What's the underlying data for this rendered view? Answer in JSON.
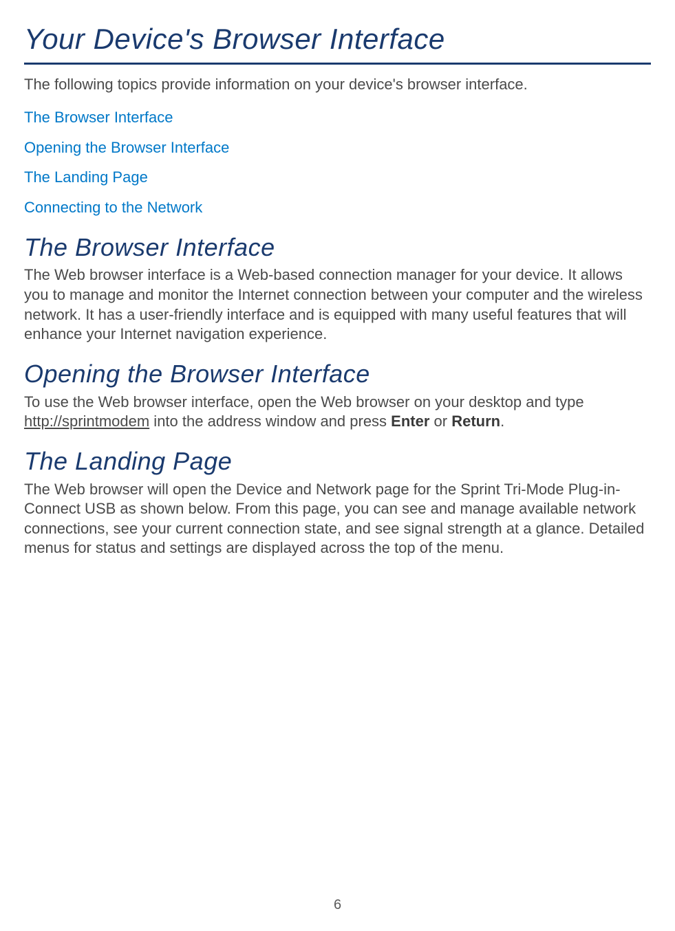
{
  "title": "Your Device's Browser Interface",
  "intro": "The following topics provide information on your device's browser interface.",
  "toc": {
    "items": [
      {
        "label": "The Browser Interface"
      },
      {
        "label": "Opening the Browser Interface"
      },
      {
        "label": "The Landing Page"
      },
      {
        "label": "Connecting to the Network"
      }
    ]
  },
  "sections": {
    "browser_interface": {
      "heading": "The Browser Interface",
      "body": "The Web browser interface is a Web-based connection manager for your device. It allows you to manage and monitor the Internet connection between your computer and the wireless network. It has a user-friendly interface and is equipped with many useful features that will enhance your Internet navigation experience."
    },
    "opening": {
      "heading": "Opening the Browser Interface",
      "body_pre": "To use the Web browser interface, open the Web browser on your desktop and type ",
      "url": "http://sprintmodem",
      "body_mid": " into the address window and press ",
      "key1": "Enter",
      "or": " or ",
      "key2": "Return",
      "period": "."
    },
    "landing": {
      "heading": "The Landing Page",
      "body": "The Web browser will open the Device and Network page for the Sprint Tri-Mode Plug-in-Connect USB as shown below. From this page, you can see and manage available network connections, see your current connection state, and see signal strength at a glance. Detailed menus for status and settings are displayed across the top of the menu."
    }
  },
  "page_number": "6"
}
